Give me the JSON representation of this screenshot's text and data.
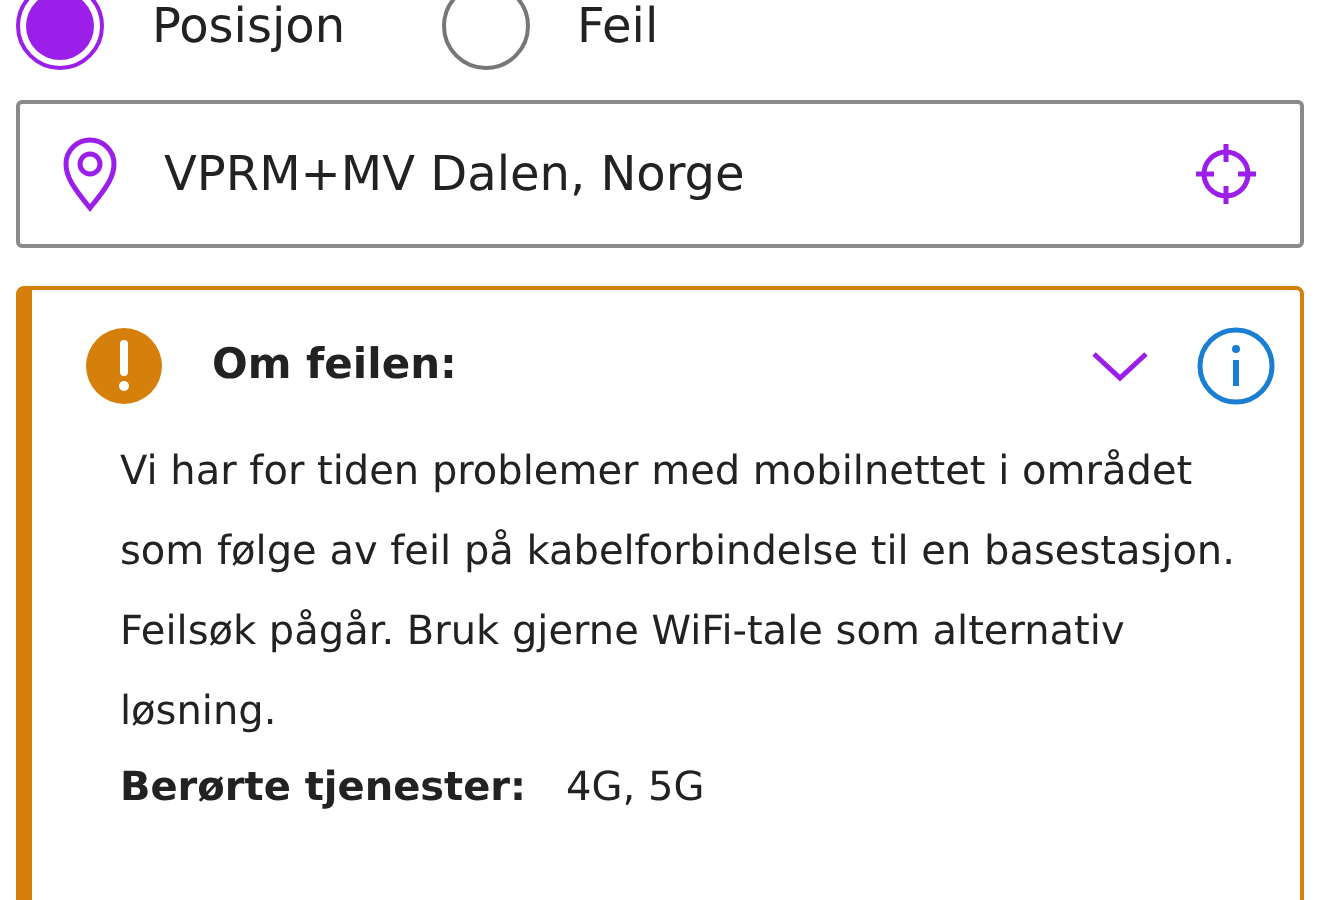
{
  "radios": [
    {
      "label": "Posisjon",
      "selected": true
    },
    {
      "label": "Feil",
      "selected": false
    }
  ],
  "location_field": {
    "value": "VPRM+MV Dalen, Norge"
  },
  "alert": {
    "title": "Om feilen:",
    "expanded": true,
    "message": "Vi har for tiden problemer med mobilnettet i området som følge av feil på kabelforbindelse til en basestasjon. Feilsøk pågår. Bruk gjerne WiFi-tale som alternativ løsning.",
    "details": [
      {
        "label": "Berørte tjenester:",
        "value": "4G, 5G"
      }
    ]
  }
}
